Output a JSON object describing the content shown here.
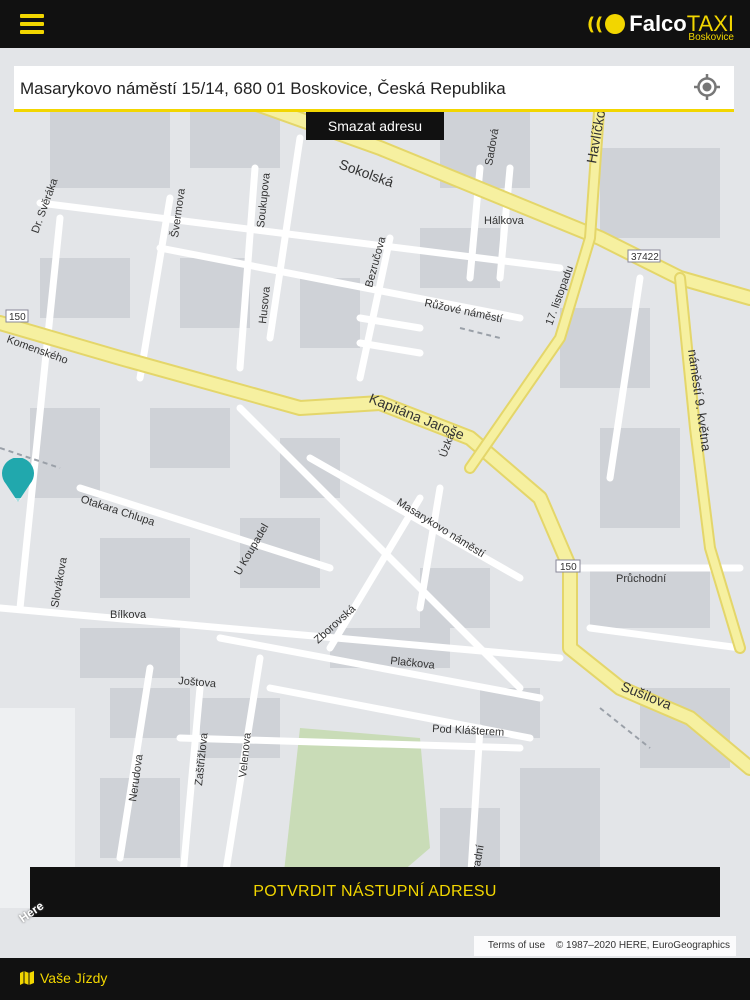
{
  "header": {
    "logo_brand": "Falco",
    "logo_taxi": "TAXI",
    "logo_sub": "Boskovice"
  },
  "address": {
    "value": "Masarykovo náměstí 15/14, 680 01 Boskovice, Česká Republika"
  },
  "clear_label": "Smazat adresu",
  "confirm_label": "POTVRDIT NÁSTUPNÍ ADRESU",
  "attribution": {
    "terms": "Terms of use",
    "copyright": "© 1987–2020 HERE, EuroGeographics"
  },
  "here_logo": "Here",
  "bottom": {
    "rides_label": "Vaše Jízdy"
  },
  "map": {
    "streets": [
      "Sokolská",
      "Havlíčkova",
      "Sadová",
      "Hálkova",
      "Dr. Svěráka",
      "Švermova",
      "Soukupova",
      "Husova",
      "Bezručova",
      "Růžové náměstí",
      "17. listopadu",
      "náměstí 9. května",
      "Komenského",
      "Kapitána Jaroše",
      "Úzká",
      "Masarykovo náměstí",
      "Otakara Chlupa",
      "U Koupadel",
      "Slovákova",
      "Bílkova",
      "Průchodní",
      "Zborovská",
      "Plačkova",
      "Joštova",
      "Pod Klášterem",
      "Sušilova",
      "Nerudova",
      "Zaštřižlova",
      "Velenova",
      "Hradní"
    ],
    "road_numbers": [
      "150",
      "37422",
      "150"
    ],
    "colors": {
      "background": "#e3e5e8",
      "block": "#cfd2d7",
      "street": "#ffffff",
      "main_road": "#f6f0a0",
      "main_road_edge": "#e4d66a",
      "park": "#c9dcb7",
      "pin": "#21a8ad"
    }
  },
  "colors": {
    "accent": "#f2d600",
    "bar": "#111111"
  }
}
